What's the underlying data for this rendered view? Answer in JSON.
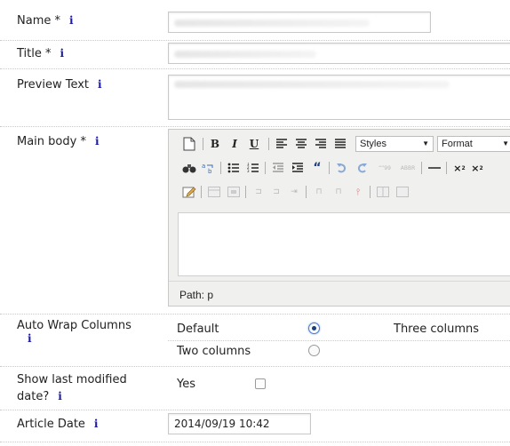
{
  "fields": {
    "name": {
      "label": "Name *",
      "info": "i"
    },
    "title": {
      "label": "Title *",
      "info": "i"
    },
    "preview": {
      "label": "Preview Text",
      "info": "i"
    },
    "main_body": {
      "label": "Main body *",
      "info": "i"
    },
    "auto_wrap": {
      "label": "Auto Wrap Columns",
      "info": "i"
    },
    "show_modified": {
      "label_line1": "Show last modified",
      "label_line2": "date?",
      "info": "i"
    },
    "article_date": {
      "label": "Article Date",
      "info": "i",
      "value": "2014/09/19 10:42"
    }
  },
  "editor": {
    "toolbar": {
      "bold": "B",
      "italic": "I",
      "underline": "U",
      "styles_label": "Styles",
      "format_label": "Format"
    },
    "path_text": "Path: p"
  },
  "wrap_options": {
    "default_label": "Default",
    "two_label": "Two columns",
    "three_label": "Three columns",
    "selected": "Default"
  },
  "show_modified_option": {
    "label": "Yes",
    "checked": false
  }
}
